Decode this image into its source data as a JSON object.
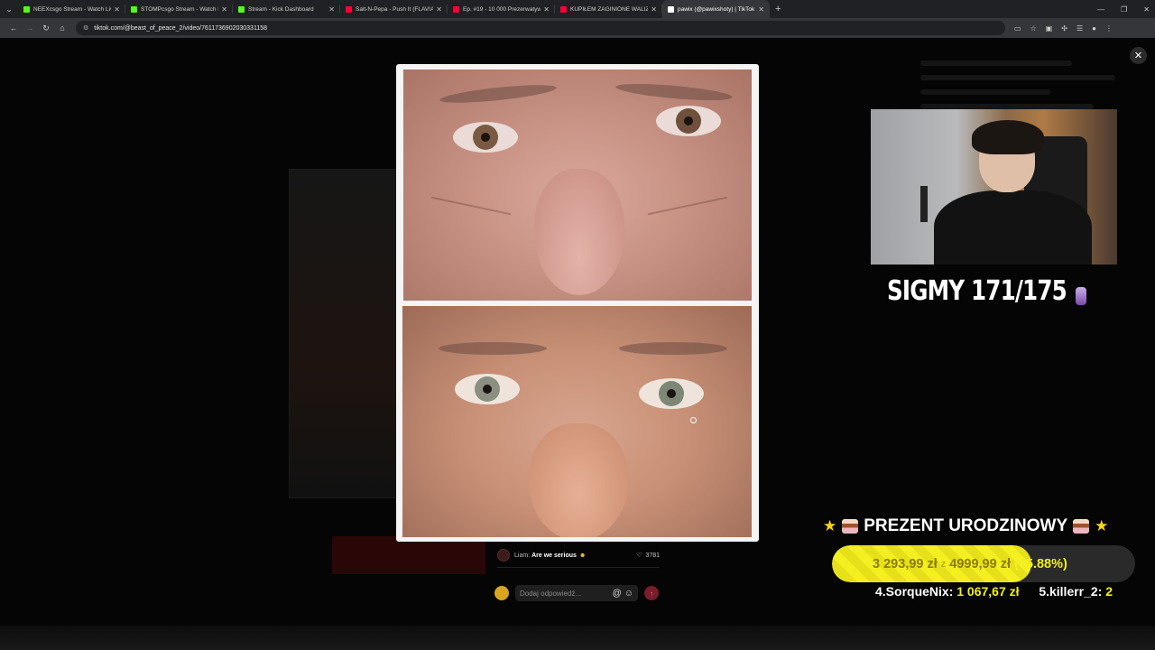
{
  "browser": {
    "tabs": [
      {
        "title": "NEEXcsgo Stream - Watch Live",
        "fav_color": "#53fc18"
      },
      {
        "title": "STOMPcsgo Stream - Watch Live",
        "fav_color": "#53fc18"
      },
      {
        "title": "Stream - Kick Dashboard",
        "fav_color": "#53fc18"
      },
      {
        "title": "Salt-N-Pepa - Push It (FLAVIA)",
        "fav_color": "#ff0033"
      },
      {
        "title": "Ep. #19 - 10 000 Prezerwatyw",
        "fav_color": "#ff0033"
      },
      {
        "title": "KUPIŁEM ZAGINIONE WALIZKI",
        "fav_color": "#ff0033"
      },
      {
        "title": "pawix (@pawixshoty) | TikTok",
        "fav_color": "#ffffff",
        "active": true
      }
    ],
    "new_tab_glyph": "+",
    "url": "tiktok.com/@beast_of_peace_2/video/7611736902030331158"
  },
  "overlay": {
    "close_glyph": "✕"
  },
  "comment": {
    "user": "Liam:",
    "text": "Are we serious",
    "emoji": "☻",
    "likes": "3781",
    "like_icon": "♡"
  },
  "reply": {
    "placeholder": "Dodaj odpowiedź...",
    "mention_icon": "@",
    "emoji_icon": "☺",
    "send_icon": "↑"
  },
  "stream": {
    "sigmy": "SIGMY 171/175",
    "goal": {
      "star": "★",
      "title": "PREZENT URODZINOWY",
      "current": "3 293,99 zł",
      "separator": "z",
      "target": "4999,99 zł",
      "percent_text": "(65.88%)",
      "progress": 0.6588
    },
    "donors": [
      {
        "label": "4.SorqueNix:",
        "amount": "1 067,67 zł"
      },
      {
        "label": "5.killerr_2:",
        "amount": "2"
      }
    ]
  },
  "colors": {
    "accent_yellow": "#f4ef1f",
    "kick_green": "#53fc18",
    "youtube_red": "#ff0033",
    "tiktok_send": "#7a1c2c"
  }
}
